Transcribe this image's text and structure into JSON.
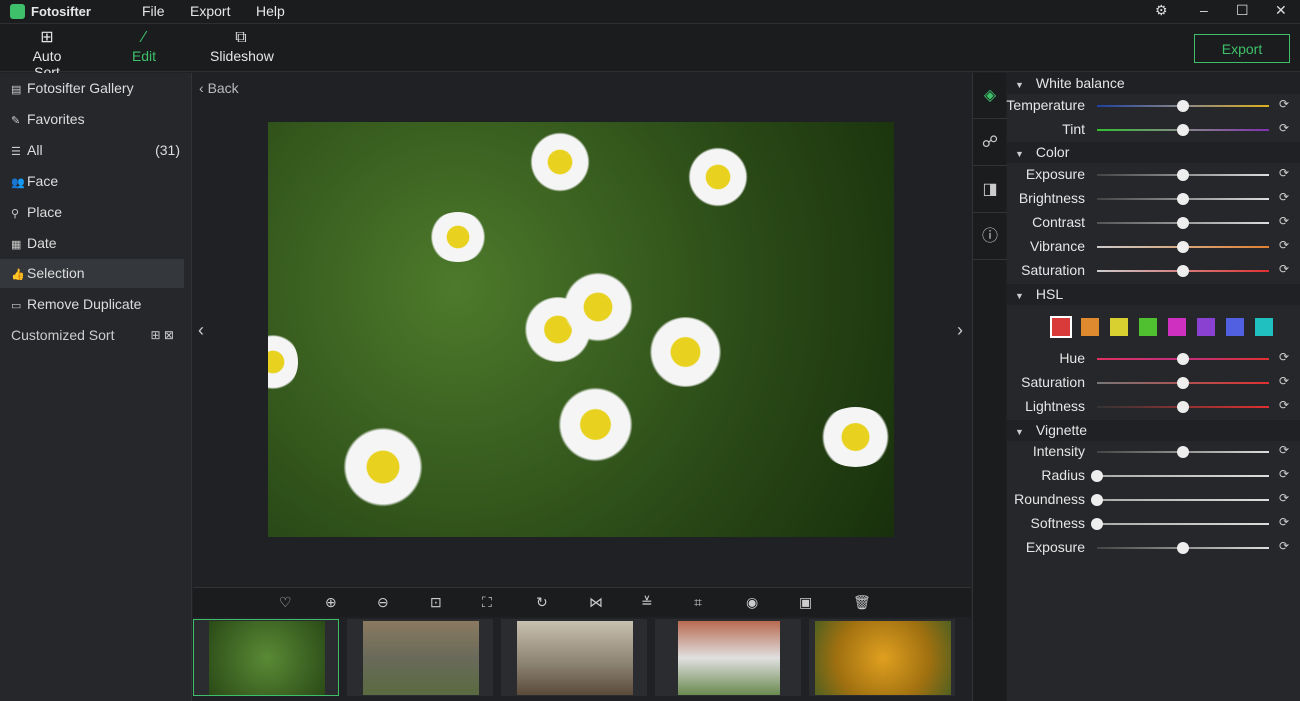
{
  "app": {
    "title": "Fotosifter",
    "menu": [
      "File",
      "Export",
      "Help"
    ]
  },
  "toolbar": {
    "tools": [
      {
        "label": "Auto Sort",
        "icon": "auto-sort-icon"
      },
      {
        "label": "Edit",
        "icon": "magic-wand-icon",
        "active": true
      },
      {
        "label": "Slideshow",
        "icon": "slideshow-icon"
      }
    ],
    "export_label": "Export"
  },
  "sidebar": {
    "items": [
      {
        "label": "Fotosifter Gallery",
        "icon": "gallery-icon"
      },
      {
        "label": "Favorites",
        "icon": "favorites-icon"
      },
      {
        "label": "All",
        "icon": "list-icon",
        "count": "(31)"
      },
      {
        "label": "Face",
        "icon": "face-icon"
      },
      {
        "label": "Place",
        "icon": "place-icon"
      },
      {
        "label": "Date",
        "icon": "calendar-icon"
      },
      {
        "label": "Selection",
        "icon": "thumbs-up-icon",
        "selected": true
      },
      {
        "label": "Remove Duplicate",
        "icon": "duplicate-icon"
      },
      {
        "label": "Customized Sort",
        "icon": ""
      }
    ]
  },
  "viewer": {
    "back_label": "Back"
  },
  "image_tools": [
    "heart",
    "zoom-in",
    "zoom-out",
    "fit",
    "fullscreen",
    "rotate",
    "flip-horizontal",
    "flip-vertical",
    "crop",
    "eye",
    "compare",
    "delete"
  ],
  "panel": {
    "sections": [
      {
        "title": "White balance",
        "sliders": [
          {
            "label": "Temperature",
            "value": 0.5,
            "gradient": [
              "#2040a0",
              "#888",
              "#e0b020"
            ]
          },
          {
            "label": "Tint",
            "value": 0.5,
            "gradient": [
              "#30c030",
              "#888",
              "#8030b0"
            ]
          }
        ]
      },
      {
        "title": "Color",
        "sliders": [
          {
            "label": "Exposure",
            "value": 0.5,
            "gradient": [
              "#444",
              "#ddd"
            ]
          },
          {
            "label": "Brightness",
            "value": 0.5,
            "gradient": [
              "#444",
              "#ddd"
            ]
          },
          {
            "label": "Contrast",
            "value": 0.5,
            "gradient": [
              "#555",
              "#ddd"
            ]
          },
          {
            "label": "Vibrance",
            "value": 0.5,
            "gradient": [
              "#ccc",
              "#e08030"
            ]
          },
          {
            "label": "Saturation",
            "value": 0.5,
            "gradient": [
              "#ccc",
              "#e03030"
            ]
          }
        ]
      },
      {
        "title": "HSL",
        "swatches": [
          "#d93a3a",
          "#e08a30",
          "#d8d030",
          "#50c030",
          "#d030c0",
          "#8a40d0",
          "#5060e0",
          "#20c0c0"
        ],
        "sliders": [
          {
            "label": "Hue",
            "value": 0.5,
            "gradient": [
              "#e03060",
              "#c03080",
              "#e03030"
            ]
          },
          {
            "label": "Saturation",
            "value": 0.5,
            "gradient": [
              "#777",
              "#e03030"
            ]
          },
          {
            "label": "Lightness",
            "value": 0.5,
            "gradient": [
              "#333",
              "#e03030"
            ]
          }
        ]
      },
      {
        "title": "Vignette",
        "sliders": [
          {
            "label": "Intensity",
            "value": 0.5,
            "gradient": [
              "#444",
              "#ddd"
            ]
          },
          {
            "label": "Radius",
            "value": 0,
            "gradient": [
              "#aaa",
              "#ddd"
            ]
          },
          {
            "label": "Roundness",
            "value": 0,
            "gradient": [
              "#aaa",
              "#ddd"
            ]
          },
          {
            "label": "Softness",
            "value": 0,
            "gradient": [
              "#aaa",
              "#ddd"
            ]
          },
          {
            "label": "Exposure",
            "value": 0.5,
            "gradient": [
              "#444",
              "#ddd"
            ]
          }
        ]
      }
    ]
  },
  "accent": "#3ec06a"
}
